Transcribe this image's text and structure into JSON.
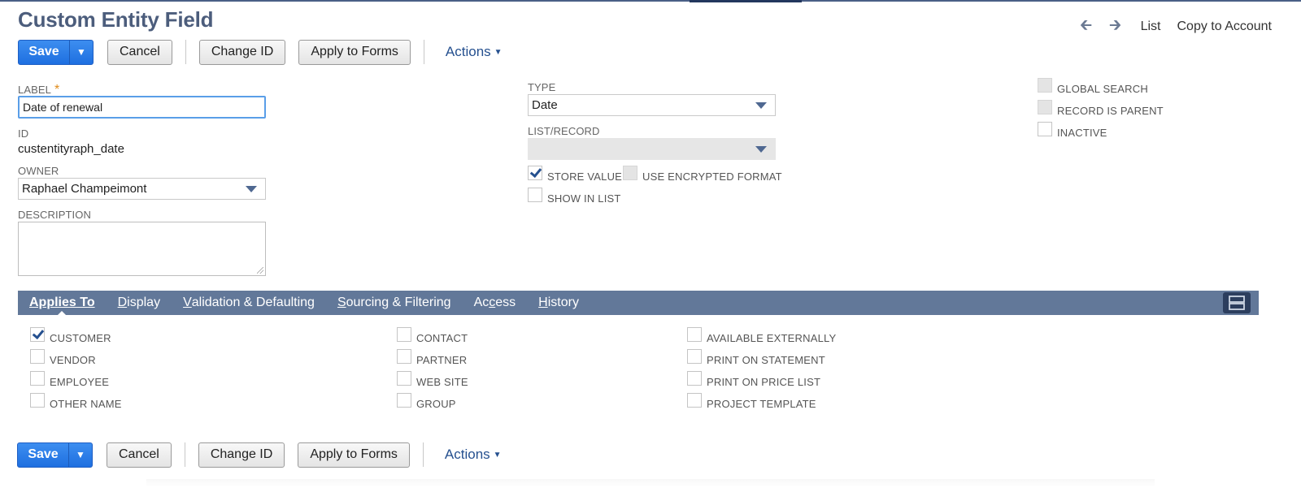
{
  "page": {
    "title": "Custom Entity Field"
  },
  "nav": {
    "back_icon": "arrow-left-icon",
    "forward_icon": "arrow-right-icon",
    "list": "List",
    "copy_to_account": "Copy to Account"
  },
  "toolbar": {
    "save": "Save",
    "save_dropdown_glyph": "▼",
    "cancel": "Cancel",
    "change_id": "Change ID",
    "apply_to_forms": "Apply to Forms",
    "actions": "Actions",
    "actions_caret": "▼"
  },
  "form": {
    "label": {
      "label": "LABEL",
      "required_mark": "*",
      "value": "Date of renewal"
    },
    "id": {
      "label": "ID",
      "value": "custentityraph_date"
    },
    "owner": {
      "label": "OWNER",
      "value": "Raphael Champeimont"
    },
    "description": {
      "label": "DESCRIPTION",
      "value": ""
    },
    "type": {
      "label": "TYPE",
      "value": "Date"
    },
    "list_record": {
      "label": "LIST/RECORD",
      "value": ""
    },
    "store_value": {
      "label": "STORE VALUE",
      "checked": true
    },
    "use_encrypted": {
      "label": "USE ENCRYPTED FORMAT",
      "checked": false,
      "disabled": true
    },
    "show_in_list": {
      "label": "SHOW IN LIST",
      "checked": false
    },
    "global_search": {
      "label": "GLOBAL SEARCH",
      "checked": false,
      "disabled": true
    },
    "record_is_parent": {
      "label": "RECORD IS PARENT",
      "checked": false,
      "disabled": true
    },
    "inactive": {
      "label": "INACTIVE",
      "checked": false
    }
  },
  "tabs": [
    {
      "prefix": "",
      "underline": "Applies To",
      "rest": "",
      "active": true
    },
    {
      "prefix": "",
      "underline": "D",
      "rest": "isplay",
      "active": false
    },
    {
      "prefix": "",
      "underline": "V",
      "rest": "alidation & Defaulting",
      "active": false
    },
    {
      "prefix": "",
      "underline": "S",
      "rest": "ourcing & Filtering",
      "active": false
    },
    {
      "prefix": "Ac",
      "underline": "c",
      "rest": "ess",
      "active": false
    },
    {
      "prefix": "",
      "underline": "H",
      "rest": "istory",
      "active": false
    }
  ],
  "tab_toggle_icon": "collapse-panel-icon",
  "applies_to": {
    "col1": [
      {
        "label": "CUSTOMER",
        "checked": true
      },
      {
        "label": "VENDOR",
        "checked": false
      },
      {
        "label": "EMPLOYEE",
        "checked": false
      },
      {
        "label": "OTHER NAME",
        "checked": false
      }
    ],
    "col2": [
      {
        "label": "CONTACT",
        "checked": false
      },
      {
        "label": "PARTNER",
        "checked": false
      },
      {
        "label": "WEB SITE",
        "checked": false
      },
      {
        "label": "GROUP",
        "checked": false
      }
    ],
    "col3": [
      {
        "label": "AVAILABLE EXTERNALLY",
        "checked": false
      },
      {
        "label": "PRINT ON STATEMENT",
        "checked": false
      },
      {
        "label": "PRINT ON PRICE LIST",
        "checked": false
      },
      {
        "label": "PROJECT TEMPLATE",
        "checked": false
      }
    ]
  },
  "colors": {
    "accent": "#25508f",
    "tabbar": "#627899",
    "save": "#1e6fe0",
    "title": "#4c5d7c"
  }
}
